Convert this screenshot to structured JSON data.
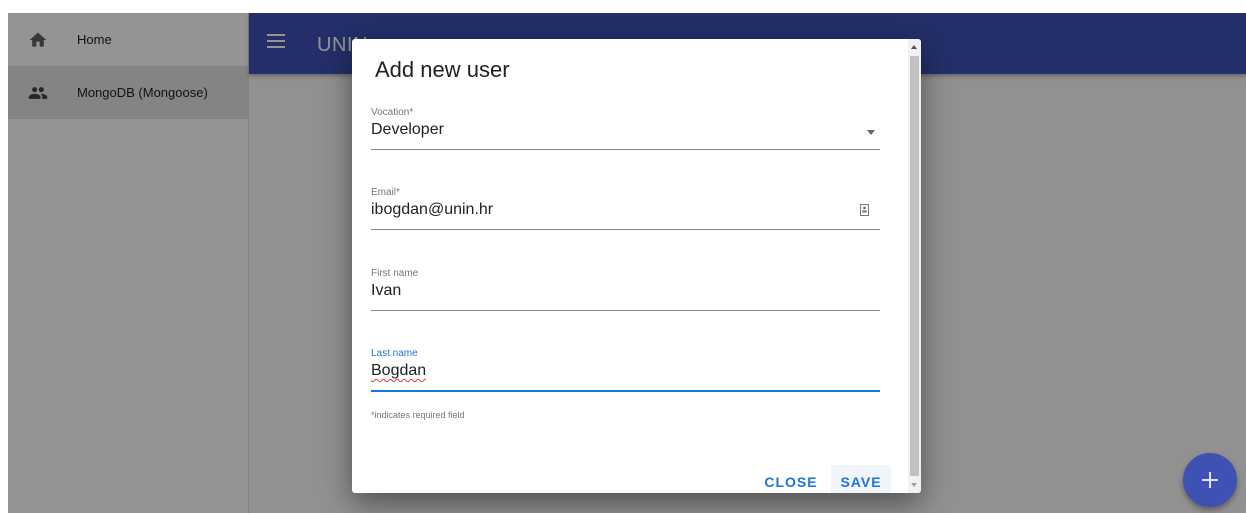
{
  "sidebar": {
    "items": [
      {
        "label": "Home",
        "icon": "home-icon"
      },
      {
        "label": "MongoDB (Mongoose)",
        "icon": "people-icon"
      }
    ]
  },
  "appbar": {
    "title": "UNIN"
  },
  "colors": {
    "primary": "#3f51b5",
    "accent": "#1976d2",
    "overlay": "rgba(0,0,0,0.42)"
  },
  "dialog": {
    "title": "Add new user",
    "fields": {
      "vocation": {
        "label": "Vocation*",
        "value": "Developer"
      },
      "email": {
        "label": "Email*",
        "value": "ibogdan@unin.hr"
      },
      "first_name": {
        "label": "First name",
        "value": "Ivan"
      },
      "last_name": {
        "label": "Last name",
        "value": "Bogdan"
      }
    },
    "helper_text": "*indicates required field",
    "close_label": "CLOSE",
    "save_label": "SAVE"
  },
  "fab": {
    "icon": "plus-icon"
  }
}
